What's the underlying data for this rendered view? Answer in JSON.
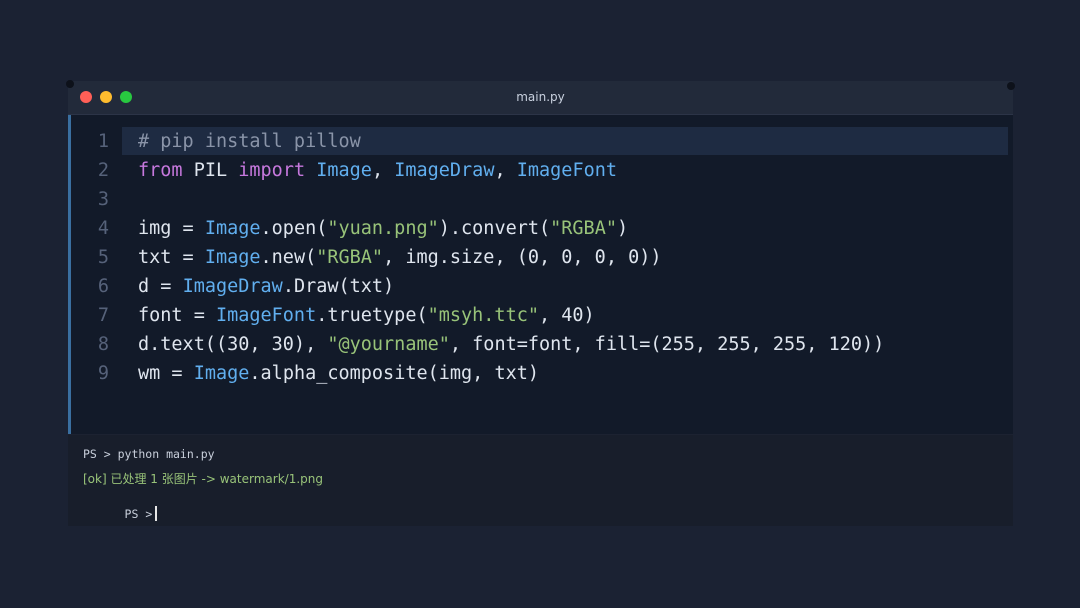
{
  "window": {
    "title": "main.py"
  },
  "editor": {
    "line_numbers": [
      "1",
      "2",
      "3",
      "4",
      "5",
      "6",
      "7",
      "8",
      "9"
    ],
    "lines": [
      {
        "tokens": [
          {
            "t": "c",
            "v": "# pip install pillow"
          }
        ]
      },
      {
        "tokens": [
          {
            "t": "k",
            "v": "from"
          },
          {
            "t": "p",
            "v": " PIL "
          },
          {
            "t": "k",
            "v": "import"
          },
          {
            "t": "p",
            "v": " "
          },
          {
            "t": "n",
            "v": "Image"
          },
          {
            "t": "p",
            "v": ", "
          },
          {
            "t": "n",
            "v": "ImageDraw"
          },
          {
            "t": "p",
            "v": ", "
          },
          {
            "t": "n",
            "v": "ImageFont"
          }
        ]
      },
      {
        "tokens": []
      },
      {
        "tokens": [
          {
            "t": "p",
            "v": "img = "
          },
          {
            "t": "n",
            "v": "Image"
          },
          {
            "t": "p",
            "v": ".open("
          },
          {
            "t": "s",
            "v": "\"yuan.png\""
          },
          {
            "t": "p",
            "v": ").convert("
          },
          {
            "t": "s",
            "v": "\"RGBA\""
          },
          {
            "t": "p",
            "v": ")"
          }
        ]
      },
      {
        "tokens": [
          {
            "t": "p",
            "v": "txt = "
          },
          {
            "t": "n",
            "v": "Image"
          },
          {
            "t": "p",
            "v": ".new("
          },
          {
            "t": "s",
            "v": "\"RGBA\""
          },
          {
            "t": "p",
            "v": ", img.size, (0, 0, 0, 0))"
          }
        ]
      },
      {
        "tokens": [
          {
            "t": "p",
            "v": "d = "
          },
          {
            "t": "n",
            "v": "ImageDraw"
          },
          {
            "t": "p",
            "v": ".Draw(txt)"
          }
        ]
      },
      {
        "tokens": [
          {
            "t": "p",
            "v": "font = "
          },
          {
            "t": "n",
            "v": "ImageFont"
          },
          {
            "t": "p",
            "v": ".truetype("
          },
          {
            "t": "s",
            "v": "\"msyh.ttc\""
          },
          {
            "t": "p",
            "v": ", 40)"
          }
        ]
      },
      {
        "tokens": [
          {
            "t": "p",
            "v": "d.text((30, 30), "
          },
          {
            "t": "s",
            "v": "\"@yourname\""
          },
          {
            "t": "p",
            "v": ", font=font, fill=(255, 255, 255, 120))"
          }
        ]
      },
      {
        "tokens": [
          {
            "t": "p",
            "v": "wm = "
          },
          {
            "t": "n",
            "v": "Image"
          },
          {
            "t": "p",
            "v": ".alpha_composite(img, txt)"
          }
        ]
      }
    ]
  },
  "terminal": {
    "command_line": "PS > python main.py",
    "output_line": "[ok] 已处理 1 张图片 -> watermark/1.png",
    "prompt": "PS >"
  }
}
